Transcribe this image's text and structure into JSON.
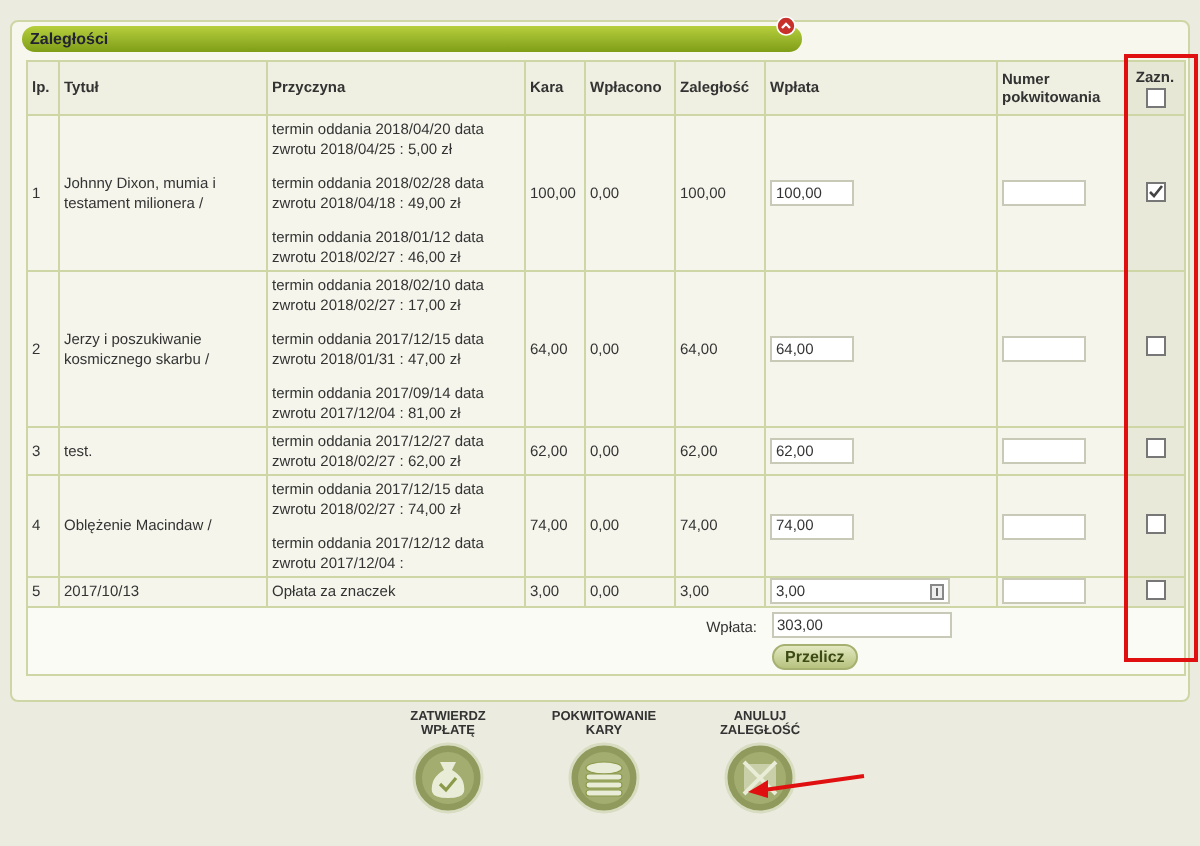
{
  "panel": {
    "title": "Zaległości"
  },
  "table": {
    "columns": [
      "lp.",
      "Tytuł",
      "Przyczyna",
      "Kara",
      "Wpłacono",
      "Zaległość",
      "Wpłata",
      "Numer pokwitowania",
      "Zazn."
    ],
    "select_all": {
      "checked": false
    },
    "rows": [
      {
        "lp": "1",
        "title": "Johnny Dixon, mumia i testament milionera /",
        "reasons": [
          "termin oddania 2018/04/20 data zwrotu 2018/04/25 : 5,00 zł",
          "termin oddania 2018/02/28 data zwrotu 2018/04/18 : 49,00 zł",
          "termin oddania 2018/01/12 data zwrotu 2018/02/27 : 46,00 zł"
        ],
        "fine": "100,00",
        "paid": "0,00",
        "due": "100,00",
        "payment": "100,00",
        "spin_icon": false,
        "checked": true
      },
      {
        "lp": "2",
        "title": "Jerzy i poszukiwanie kosmicznego skarbu /",
        "reasons": [
          "termin oddania 2018/02/10 data zwrotu 2018/02/27 : 17,00 zł",
          "termin oddania 2017/12/15 data zwrotu 2018/01/31 : 47,00 zł",
          "termin oddania 2017/09/14 data zwrotu 2017/12/04 : 81,00 zł"
        ],
        "fine": "64,00",
        "paid": "0,00",
        "due": "64,00",
        "payment": "64,00",
        "spin_icon": false,
        "checked": false
      },
      {
        "lp": "3",
        "title": "test.",
        "reasons": [
          "termin oddania 2017/12/27 data zwrotu 2018/02/27 : 62,00 zł"
        ],
        "fine": "62,00",
        "paid": "0,00",
        "due": "62,00",
        "payment": "62,00",
        "spin_icon": false,
        "checked": false
      },
      {
        "lp": "4",
        "title": "Oblężenie Macindaw /",
        "reasons": [
          "termin oddania 2017/12/15 data zwrotu 2018/02/27 : 74,00 zł",
          "termin oddania 2017/12/12 data zwrotu 2017/12/04 :"
        ],
        "fine": "74,00",
        "paid": "0,00",
        "due": "74,00",
        "payment": "74,00",
        "spin_icon": false,
        "checked": false
      },
      {
        "lp": "5",
        "title": "2017/10/13",
        "reasons": [
          "Opłata za znaczek"
        ],
        "fine": "3,00",
        "paid": "0,00",
        "due": "3,00",
        "payment": "3,00",
        "spin_icon": true,
        "checked": false
      }
    ],
    "total": {
      "label": "Wpłata:",
      "value": "303,00"
    },
    "recalc_button": "Przelicz"
  },
  "actions": [
    {
      "lines": [
        "ZATWIERDZ",
        "WPŁATĘ"
      ],
      "kind": "bag"
    },
    {
      "lines": [
        "POKWITOWANIE",
        "KARY"
      ],
      "kind": "coins"
    },
    {
      "lines": [
        "ANULUJ",
        "ZALEGŁOŚĆ"
      ],
      "kind": "cancel"
    }
  ]
}
